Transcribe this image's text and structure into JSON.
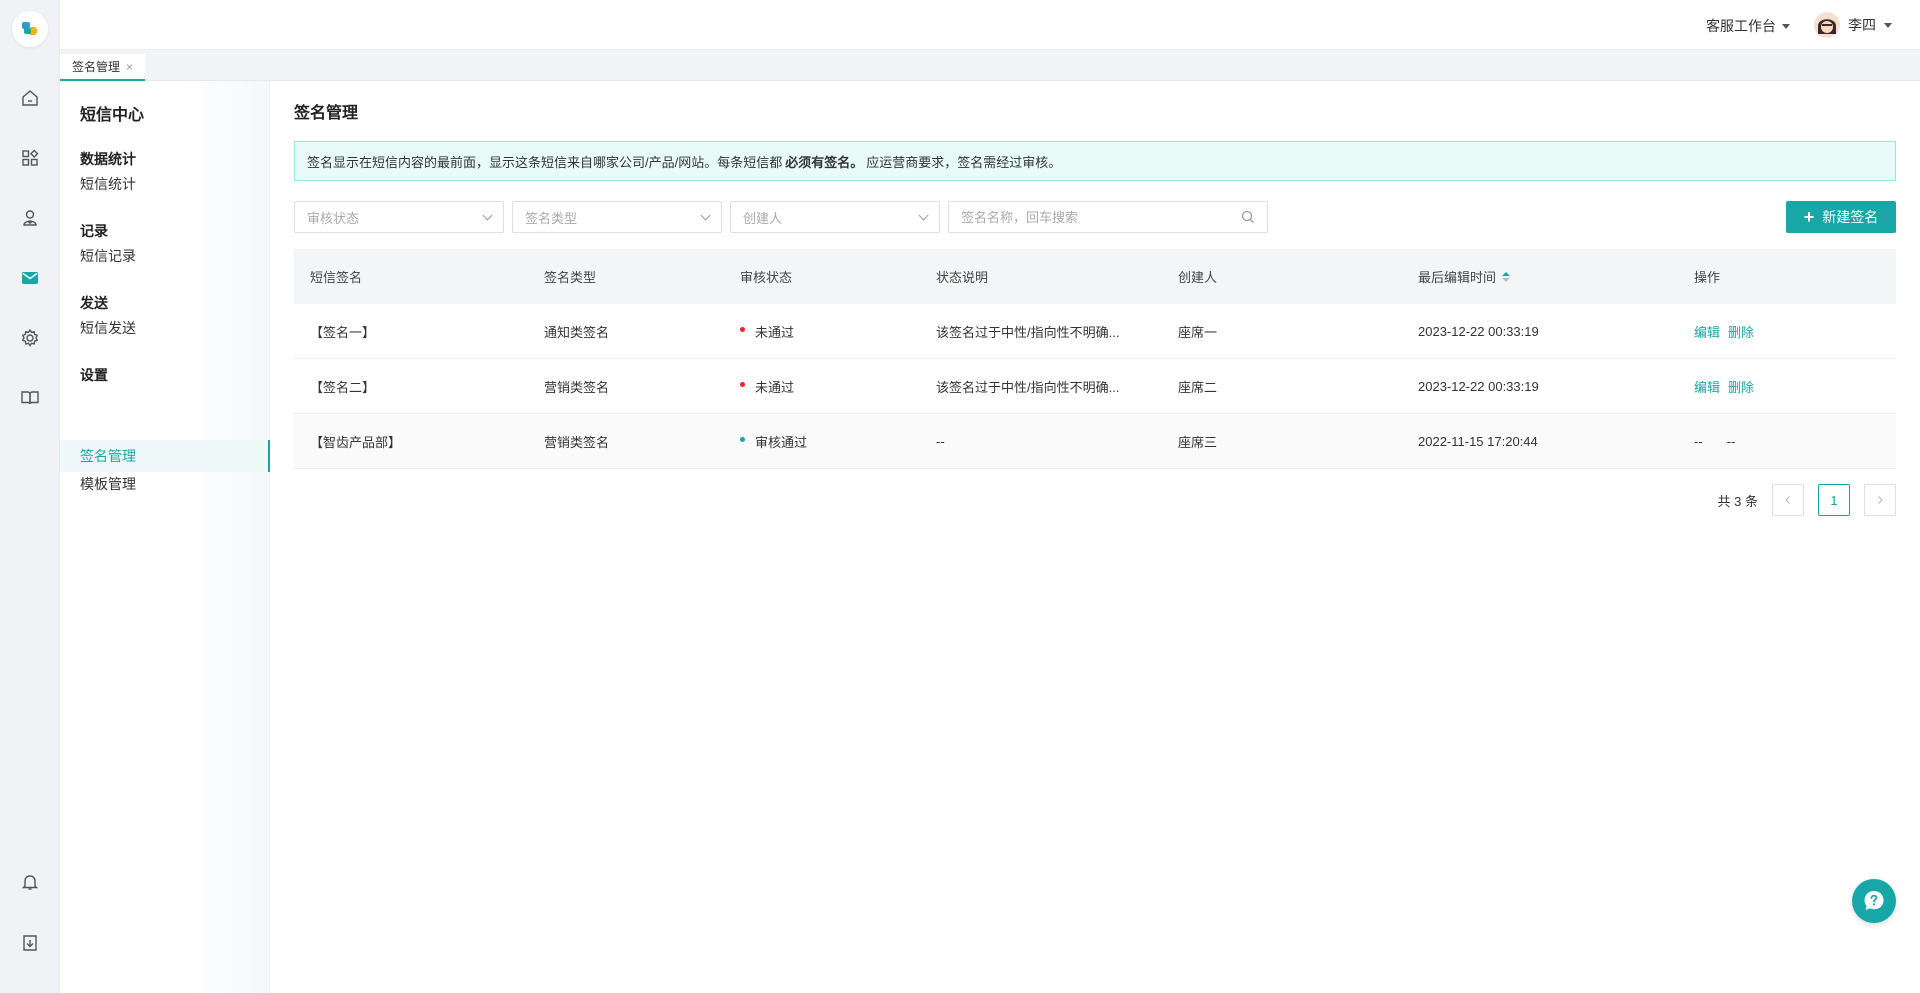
{
  "header": {
    "workspace_label": "客服工作台",
    "user_name": "李四"
  },
  "tabs": [
    {
      "label": "签名管理",
      "close": "×"
    }
  ],
  "subnav": {
    "title": "短信中心",
    "groups": [
      {
        "title": "数据统计",
        "items": [
          "短信统计"
        ]
      },
      {
        "title": "记录",
        "items": [
          "短信记录"
        ]
      },
      {
        "title": "发送",
        "items": [
          "短信发送"
        ]
      },
      {
        "title": "设置",
        "items": [
          "签名管理",
          "模板管理"
        ]
      }
    ]
  },
  "page": {
    "title": "签名管理",
    "notice_prefix": "签名显示在短信内容的最前面，显示这条短信来自哪家公司/产品/网站。每条短信都",
    "notice_bold": "必须有签名。",
    "notice_suffix": "应运营商要求，签名需经过审核。"
  },
  "filters": {
    "audit_status_placeholder": "审核状态",
    "sign_type_placeholder": "签名类型",
    "creator_placeholder": "创建人",
    "search_placeholder": "签名名称，回车搜索"
  },
  "new_button_label": "新建签名",
  "table": {
    "columns": [
      "短信签名",
      "签名类型",
      "审核状态",
      "状态说明",
      "创建人",
      "最后编辑时间",
      "操作"
    ],
    "rows": [
      {
        "name": "【签名一】",
        "type": "通知类签名",
        "status": "未通过",
        "status_color": "#f5222d",
        "desc": "该签名过于中性/指向性不明确...",
        "creator": "座席一",
        "time": "2023-12-22 00:33:19",
        "action1": "编辑",
        "action2": "删除"
      },
      {
        "name": "【签名二】",
        "type": "营销类签名",
        "status": "未通过",
        "status_color": "#f5222d",
        "desc": "该签名过于中性/指向性不明确...",
        "creator": "座席二",
        "time": "2023-12-22 00:33:19",
        "action1": "编辑",
        "action2": "删除"
      },
      {
        "name": "【智齿产品部】",
        "type": "营销类签名",
        "status": "审核通过",
        "status_color": "#18a7a7",
        "desc": "--",
        "creator": "座席三",
        "time": "2022-11-15 17:20:44",
        "action1": "--",
        "action2": "--"
      }
    ]
  },
  "pagination": {
    "total_text": "共 3 条",
    "current_page": "1"
  },
  "colors": {
    "accent": "#18a7a7",
    "danger": "#f5222d"
  }
}
